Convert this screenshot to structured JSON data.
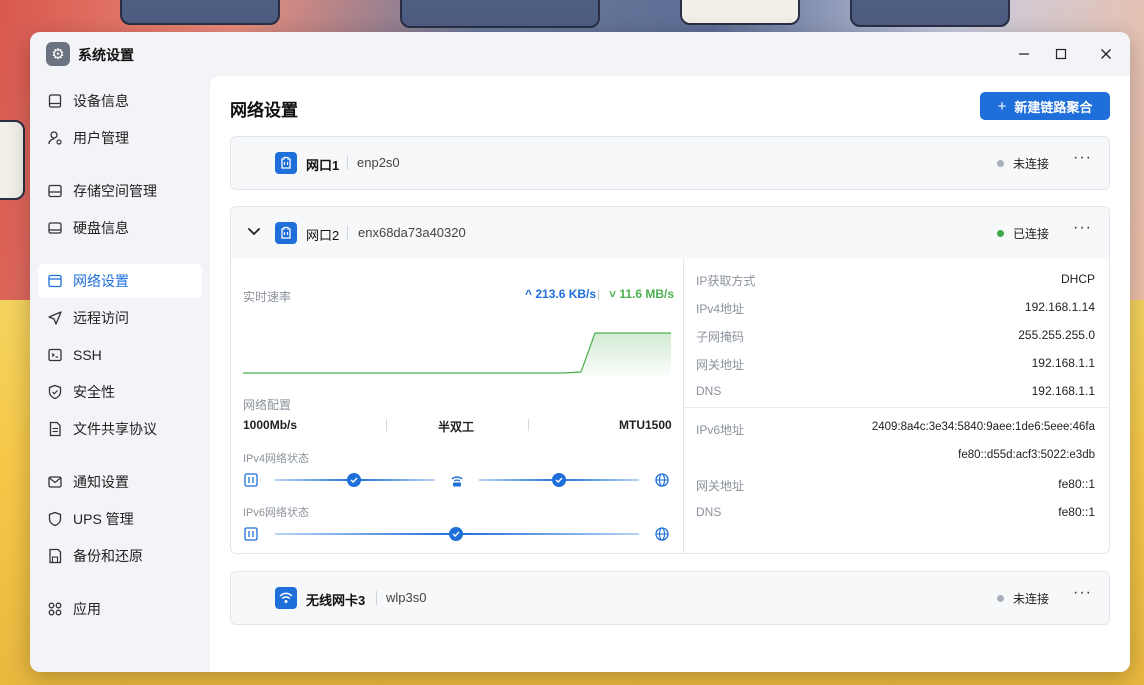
{
  "window": {
    "title": "系统设置",
    "controls": {
      "minimize": "—",
      "maximize": "☐",
      "close": "✕"
    }
  },
  "sidebar": {
    "items": [
      {
        "label": "设备信息",
        "icon": "device-icon",
        "active": false
      },
      {
        "label": "用户管理",
        "icon": "user-icon",
        "active": false
      },
      {
        "label": "存储空间管理",
        "icon": "storage-icon",
        "active": false
      },
      {
        "label": "硬盘信息",
        "icon": "disk-icon",
        "active": false
      },
      {
        "label": "网络设置",
        "icon": "network-icon",
        "active": true
      },
      {
        "label": "远程访问",
        "icon": "send-icon",
        "active": false
      },
      {
        "label": "SSH",
        "icon": "terminal-icon",
        "active": false
      },
      {
        "label": "安全性",
        "icon": "shield-icon",
        "active": false
      },
      {
        "label": "文件共享协议",
        "icon": "file-icon",
        "active": false
      },
      {
        "label": "通知设置",
        "icon": "mail-icon",
        "active": false
      },
      {
        "label": "UPS 管理",
        "icon": "ups-icon",
        "active": false
      },
      {
        "label": "备份和还原",
        "icon": "backup-icon",
        "active": false
      },
      {
        "label": "应用",
        "icon": "apps-icon",
        "active": false
      }
    ]
  },
  "main": {
    "title": "网络设置",
    "new_bond_button": "新建链路聚合",
    "new_bond_icon": "+",
    "interfaces": [
      {
        "name": "网口1",
        "device": "enp2s0",
        "status": "未连接",
        "status_color": "#a8b0bc",
        "icon": "ethernet-port-icon",
        "more": "···"
      },
      {
        "name": "网口2",
        "device": "enx68da73a40320",
        "status": "已连接",
        "status_color": "#3ea84a",
        "icon": "ethernet-port-icon",
        "more": "···",
        "expanded": true,
        "realtime_label": "实时速率",
        "upload": "213.6 KB/s",
        "download": "11.6 MB/s",
        "upload_arrow": "^",
        "download_arrow": "˅",
        "speed_sep": "|",
        "config_label": "网络配置",
        "speed": "1000Mb/s",
        "duplex": "半双工",
        "mtu": "MTU1500",
        "ipv4_status_label": "IPv4网络状态",
        "ipv6_status_label": "IPv6网络状态",
        "ipv4": {
          "ip_method_label": "IP获取方式",
          "ip_method": "DHCP",
          "address_label": "IPv4地址",
          "address": "192.168.1.14",
          "mask_label": "子网掩码",
          "mask": "255.255.255.0",
          "gateway_label": "网关地址",
          "gateway": "192.168.1.1",
          "dns_label": "DNS",
          "dns": "192.168.1.1"
        },
        "ipv6": {
          "address_label": "IPv6地址",
          "address1": "2409:8a4c:3e34:5840:9aee:1de6:5eee:46fa",
          "address2": "fe80::d55d:acf3:5022:e3db",
          "gateway_label": "网关地址",
          "gateway": "fe80::1",
          "dns_label": "DNS",
          "dns": "fe80::1"
        }
      },
      {
        "name": "无线网卡3",
        "device": "wlp3s0",
        "status": "未连接",
        "status_color": "#a8b0bc",
        "icon": "wifi-icon",
        "more": "···"
      }
    ]
  },
  "colors": {
    "accent": "#1e6fd9",
    "connected": "#3ea84a",
    "disconnected": "#a8b0bc",
    "download": "#4caf50"
  }
}
